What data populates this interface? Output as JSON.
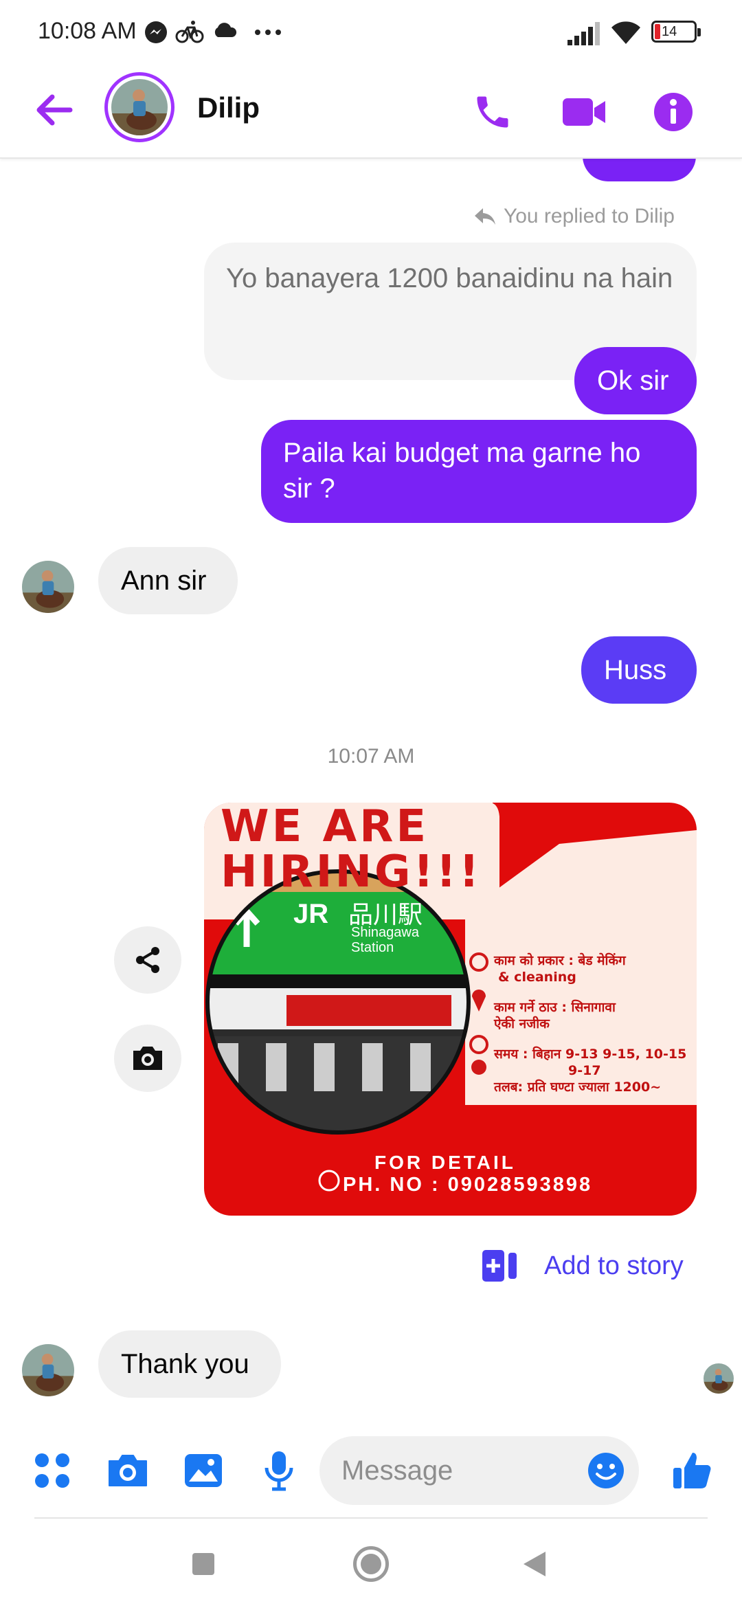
{
  "status_bar": {
    "time": "10:08 AM",
    "battery": "14"
  },
  "header": {
    "contact_name": "Dilip"
  },
  "messages": {
    "reply_context": "You replied to Dilip",
    "quoted_text": "Yo banayera 1200 banaidinu na hain",
    "reply_text": "Ok sir",
    "msg_budget": "Paila kai budget ma garne ho sir ?",
    "msg_ann": "Ann sir",
    "msg_huss": "Huss",
    "timestamp": "10:07 AM",
    "msg_thanks": "Thank you"
  },
  "poster": {
    "headline_1": "WE ARE",
    "headline_2": "HIRING!!!",
    "sign_jr": "JR",
    "sign_station_jp": "品川駅",
    "sign_station_en_1": "Shinagawa",
    "sign_station_en_2": "Station",
    "work_type_1": "काम को प्रकार : बेड मेकिंग",
    "work_type_2": "& cleaning",
    "work_place_1": "काम गर्ने ठाउ : सिनागावा",
    "work_place_2": "ऐकी नजीक",
    "time_1": "समय : बिहान 9-13 9-15, 10-15",
    "time_2": "9-17",
    "salary": "तलब: प्रति घण्टा ज्याला 1200~",
    "for_detail": "FOR DETAIL",
    "phone": "PH. NO : 09028593898"
  },
  "actions": {
    "add_to_story": "Add to story"
  },
  "composer": {
    "placeholder": "Message"
  },
  "colors": {
    "accent": "#a033ff",
    "bubble_mine": "#7a22f5",
    "poster_red": "#e00b0b",
    "story_blue": "#4b3ef0"
  }
}
